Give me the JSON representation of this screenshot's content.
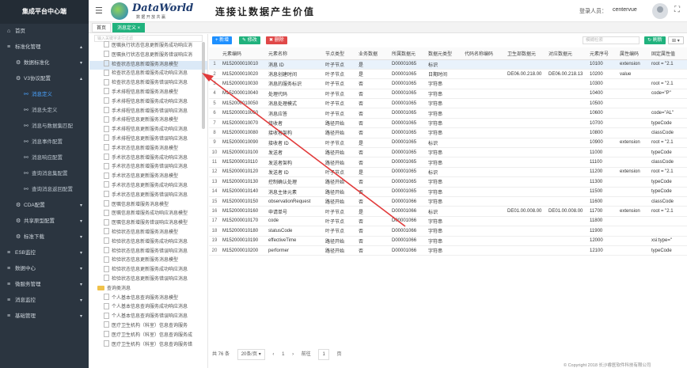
{
  "sidebar": {
    "brand": "集成平台中心端",
    "items": [
      {
        "label": "首页",
        "icon": "home-icon",
        "level": 1
      },
      {
        "label": "标准化管理",
        "icon": "list-icon",
        "level": 1,
        "arrow": "▴"
      },
      {
        "label": "数据标准化",
        "icon": "gear-icon",
        "level": 2,
        "arrow": "▾"
      },
      {
        "label": "V3协议配置",
        "icon": "gear-icon",
        "level": 2,
        "arrow": "▴"
      },
      {
        "label": "消息定义",
        "icon": "link-icon",
        "level": 3,
        "active": true
      },
      {
        "label": "消息头定义",
        "icon": "link-icon",
        "level": 3
      },
      {
        "label": "消息与数据集匹配",
        "icon": "link-icon",
        "level": 3
      },
      {
        "label": "消息事件配置",
        "icon": "link-icon",
        "level": 3
      },
      {
        "label": "消息响应配置",
        "icon": "link-icon",
        "level": 3
      },
      {
        "label": "查询消息集配置",
        "icon": "link-icon",
        "level": 3
      },
      {
        "label": "查询消息返回配置",
        "icon": "link-icon",
        "level": 3
      },
      {
        "label": "CDA配置",
        "icon": "gear-icon",
        "level": 2,
        "arrow": "▾"
      },
      {
        "label": "共享原型配置",
        "icon": "gear-icon",
        "level": 2,
        "arrow": "▾"
      },
      {
        "label": "标准下载",
        "icon": "gear-icon",
        "level": 2,
        "arrow": "▾"
      },
      {
        "label": "ESB监控",
        "icon": "list-icon",
        "level": 1,
        "arrow": "▾"
      },
      {
        "label": "数据中心",
        "icon": "list-icon",
        "level": 1,
        "arrow": "▾"
      },
      {
        "label": "微服务管理",
        "icon": "list-icon",
        "level": 1,
        "arrow": "▾"
      },
      {
        "label": "消息监控",
        "icon": "list-icon",
        "level": 1,
        "arrow": "▾"
      },
      {
        "label": "基础管理",
        "icon": "list-icon",
        "level": 1,
        "arrow": "▾"
      }
    ]
  },
  "header": {
    "logo_text": "DataWorld",
    "logo_sub": "数 据 开 放 共 赢",
    "slogan": "连接让数据产生价值",
    "user_label": "登录人员：",
    "user_name": "centervue"
  },
  "tabs": [
    {
      "label": "首页"
    },
    {
      "label": "消息定义 ×"
    }
  ],
  "tree": {
    "search_placeholder": "输入关键字进行过滤",
    "rows": [
      {
        "label": "医嘱执行状态信息更新服务成功响应消",
        "type": "doc"
      },
      {
        "label": "医嘱执行状态信息更新服务错误响应消",
        "type": "doc"
      },
      {
        "label": "检查状态信息新增服务消息模型",
        "type": "doc",
        "selected": true
      },
      {
        "label": "检查状态信息新增服务成功响应消息",
        "type": "doc"
      },
      {
        "label": "检查状态信息新增服务错误响应消息",
        "type": "doc"
      },
      {
        "label": "手术排程信息新增服务消息模型",
        "type": "doc"
      },
      {
        "label": "手术排程信息新增服务成功响应消息",
        "type": "doc"
      },
      {
        "label": "手术排程信息新增服务错误响应消息",
        "type": "doc"
      },
      {
        "label": "手术排程信息更新服务消息模型",
        "type": "doc"
      },
      {
        "label": "手术排程信息更新服务成功响应消息",
        "type": "doc"
      },
      {
        "label": "手术排程信息更新服务错误响应消息",
        "type": "doc"
      },
      {
        "label": "手术状态信息新增服务消息模型",
        "type": "doc"
      },
      {
        "label": "手术状态信息新增服务成功响应消息",
        "type": "doc"
      },
      {
        "label": "手术状态信息新增服务错误响应消息",
        "type": "doc"
      },
      {
        "label": "手术状态信息更新服务消息模型",
        "type": "doc"
      },
      {
        "label": "手术状态信息更新服务成功响应消息",
        "type": "doc"
      },
      {
        "label": "手术状态信息更新服务错误响应消息",
        "type": "doc"
      },
      {
        "label": "医嘱信息新增服务消息模型",
        "type": "doc"
      },
      {
        "label": "医嘱信息新增服务成功响应消息模型",
        "type": "doc"
      },
      {
        "label": "医嘱信息新增服务错误响应消息模型",
        "type": "doc"
      },
      {
        "label": "检验状态信息新增服务消息模型",
        "type": "doc"
      },
      {
        "label": "检验状态信息新增服务成功响应消息",
        "type": "doc"
      },
      {
        "label": "检验状态信息新增服务错误响应消息",
        "type": "doc"
      },
      {
        "label": "检验状态信息更新服务消息模型",
        "type": "doc"
      },
      {
        "label": "检验状态信息更新服务成功响应消息",
        "type": "doc"
      },
      {
        "label": "检验状态信息更新服务错误响应消息",
        "type": "doc"
      },
      {
        "label": "查询类消息",
        "type": "folder"
      },
      {
        "label": "个人基本信息查询服务消息模型",
        "type": "doc"
      },
      {
        "label": "个人基本信息查询服务成功响应消息",
        "type": "doc"
      },
      {
        "label": "个人基本信息查询服务错误响应消息",
        "type": "doc"
      },
      {
        "label": "医疗卫生机构（科室）信息查询服务",
        "type": "doc"
      },
      {
        "label": "医疗卫生机构（科室）信息查询服务成",
        "type": "doc"
      },
      {
        "label": "医疗卫生机构（科室）信息查询服务错",
        "type": "doc"
      }
    ]
  },
  "toolbar": {
    "add": "+ 新增",
    "edit": "✎ 修改",
    "delete": "✖ 删除",
    "search_placeholder": "模糊检索",
    "refresh": "↻ 刷新",
    "export": "⊞ ▾"
  },
  "table": {
    "columns": [
      "",
      "元素编码",
      "元素名称",
      "节点类型",
      "业务数据",
      "所属数据元",
      "数据元类型",
      "代码名称编码",
      "卫生部数据元",
      "对应数据元",
      "元素序号",
      "属性编码",
      "固定属性值"
    ],
    "rows": [
      [
        "1",
        "M152000010010",
        "消息 ID",
        "叶子节点",
        "是",
        "D00001065",
        "标识",
        "",
        "",
        "",
        "10100",
        "extension",
        "root = \"2.1"
      ],
      [
        "2",
        "M152000010020",
        "消息创建时间",
        "叶子节点",
        "是",
        "D00001065",
        "日期时间",
        "",
        "DE06.00.218.00",
        "DE06.00.218.13",
        "10200",
        "value",
        ""
      ],
      [
        "3",
        "M152000010030",
        "消息的服务标识",
        "叶子节点",
        "否",
        "D00001065",
        "字符串",
        "",
        "",
        "",
        "10300",
        "",
        "root = \"2.1"
      ],
      [
        "4",
        "M152000010040",
        "处理代码",
        "叶子节点",
        "否",
        "D00001065",
        "字符串",
        "",
        "",
        "",
        "10400",
        "",
        "code=\"P\""
      ],
      [
        "5",
        "M152000010050",
        "消息处理模式",
        "叶子节点",
        "否",
        "D00001065",
        "字符串",
        "",
        "",
        "",
        "10500",
        "",
        ""
      ],
      [
        "6",
        "M152000010060",
        "消息应答",
        "叶子节点",
        "否",
        "D00001065",
        "字符串",
        "",
        "",
        "",
        "10600",
        "",
        "code=\"AL\""
      ],
      [
        "7",
        "M152000010070",
        "接收者",
        "路径开始",
        "否",
        "D00001065",
        "字符串",
        "",
        "",
        "",
        "10700",
        "",
        "typeCode"
      ],
      [
        "8",
        "M152000010080",
        "接收者架构",
        "路径开始",
        "否",
        "D00001065",
        "字符串",
        "",
        "",
        "",
        "10800",
        "",
        "classCode"
      ],
      [
        "9",
        "M152000010090",
        "接收者 ID",
        "叶子节点",
        "是",
        "D00001065",
        "标识",
        "",
        "",
        "",
        "10900",
        "extension",
        "root = \"2.1"
      ],
      [
        "10",
        "M152000010100",
        "发送者",
        "路径开始",
        "否",
        "D00001065",
        "字符串",
        "",
        "",
        "",
        "11000",
        "",
        "typeCode"
      ],
      [
        "11",
        "M152000010110",
        "发送者架构",
        "路径开始",
        "否",
        "D00001065",
        "字符串",
        "",
        "",
        "",
        "11100",
        "",
        "classCode"
      ],
      [
        "12",
        "M152000010120",
        "发送者 ID",
        "叶子节点",
        "是",
        "D00001065",
        "标识",
        "",
        "",
        "",
        "11200",
        "extension",
        "root = \"2.1"
      ],
      [
        "13",
        "M152000010130",
        "控制确认处理",
        "路径开始",
        "否",
        "D00001065",
        "字符串",
        "",
        "",
        "",
        "11300",
        "",
        "typeCode"
      ],
      [
        "14",
        "M152000010140",
        "消息主体元素",
        "路径开始",
        "否",
        "D00001065",
        "字符串",
        "",
        "",
        "",
        "11500",
        "",
        "typeCode"
      ],
      [
        "15",
        "M152000010150",
        "observationRequest",
        "路径开始",
        "否",
        "D00001066",
        "字符串",
        "",
        "",
        "",
        "11600",
        "",
        "classCode"
      ],
      [
        "16",
        "M152000010160",
        "申请单号",
        "叶子节点",
        "是",
        "D00001066",
        "标识",
        "",
        "DE01.00.008.00",
        "DE01.00.008.00",
        "11700",
        "extension",
        "root = \"2.1"
      ],
      [
        "17",
        "M152000010170",
        "code",
        "叶子节点",
        "否",
        "D00001066",
        "字符串",
        "",
        "",
        "",
        "11800",
        "",
        ""
      ],
      [
        "18",
        "M152000010180",
        "statusCode",
        "叶子节点",
        "否",
        "D00001066",
        "字符串",
        "",
        "",
        "",
        "11900",
        "",
        ""
      ],
      [
        "19",
        "M152000010190",
        "effectiveTime",
        "路径开始",
        "否",
        "D00001066",
        "字符串",
        "",
        "",
        "",
        "12000",
        "",
        "xsi:type=\""
      ],
      [
        "20",
        "M152000010200",
        "performer",
        "路径开始",
        "否",
        "D00001066",
        "字符串",
        "",
        "",
        "",
        "12100",
        "",
        "typeCode"
      ]
    ]
  },
  "pager": {
    "total": "共 76 条",
    "page_size": "20条/页 ▾",
    "prev": "‹",
    "page": "1",
    "next": "›",
    "goto_label": "前往",
    "goto_value": "1",
    "page_unit": "页"
  },
  "footer": {
    "copyright": "© Copyright 2018 长沙睿医软件科技有限公司"
  },
  "colors": {
    "sidebar_bg": "#2b3540",
    "accent_green": "#20b27d",
    "accent_blue": "#1e90ff",
    "danger": "#e04848",
    "annotation": "#e23b3b"
  }
}
